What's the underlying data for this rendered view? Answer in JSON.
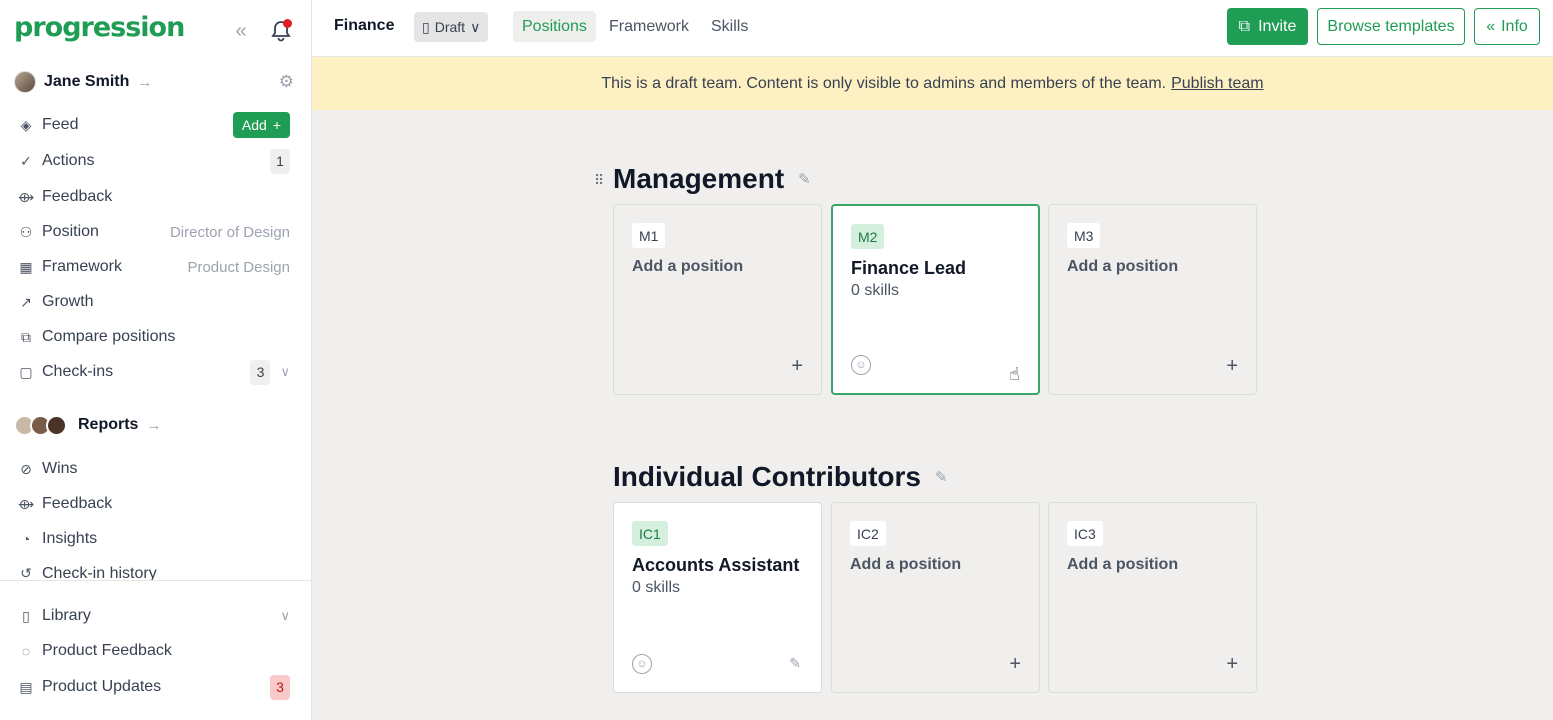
{
  "sidebar": {
    "logo": "progression",
    "user": {
      "name": "Jane Smith"
    },
    "add_label": "Add",
    "items": [
      {
        "label": "Feed"
      },
      {
        "label": "Actions",
        "badge": "1"
      },
      {
        "label": "Feedback"
      },
      {
        "label": "Position",
        "value": "Director of Design"
      },
      {
        "label": "Framework",
        "value": "Product Design"
      },
      {
        "label": "Growth"
      },
      {
        "label": "Compare positions"
      },
      {
        "label": "Check-ins",
        "badge": "3"
      }
    ],
    "reports": {
      "label": "Reports",
      "items": [
        {
          "label": "Wins"
        },
        {
          "label": "Feedback"
        },
        {
          "label": "Insights"
        },
        {
          "label": "Check-in history"
        }
      ]
    },
    "bottom": [
      {
        "label": "Library"
      },
      {
        "label": "Product Feedback"
      },
      {
        "label": "Product Updates",
        "badge": "3"
      }
    ]
  },
  "topbar": {
    "team": "Finance",
    "status": "Draft",
    "tabs": [
      "Positions",
      "Framework",
      "Skills"
    ],
    "invite": "Invite",
    "browse": "Browse templates",
    "info": "Info"
  },
  "banner": {
    "text": "This is a draft team. Content is only visible to admins and members of the team.",
    "link": "Publish team"
  },
  "sections": [
    {
      "title": "Management",
      "cards": [
        {
          "code": "M1",
          "title": "Add a position"
        },
        {
          "code": "M2",
          "title": "Finance Lead",
          "sub": "0 skills"
        },
        {
          "code": "M3",
          "title": "Add a position"
        }
      ]
    },
    {
      "title": "Individual Contributors",
      "cards": [
        {
          "code": "IC1",
          "title": "Accounts Assistant",
          "sub": "0 skills"
        },
        {
          "code": "IC2",
          "title": "Add a position"
        },
        {
          "code": "IC3",
          "title": "Add a position"
        }
      ]
    }
  ],
  "colors": {
    "accent": "#1f9d55",
    "banner": "#fdf1c4",
    "page": "#f0efed"
  },
  "icons": [
    "chevrons-left-icon",
    "bell-icon",
    "gear-icon",
    "layers-icon",
    "check-icon",
    "feedback-icon",
    "person-icon",
    "grid-icon",
    "trend-icon",
    "compare-icon",
    "clipboard-icon",
    "wins-icon",
    "pie-icon",
    "history-icon",
    "book-icon",
    "chat-icon",
    "news-icon",
    "pencil-icon",
    "plus-icon",
    "external-link-icon",
    "drag-handle-icon"
  ]
}
